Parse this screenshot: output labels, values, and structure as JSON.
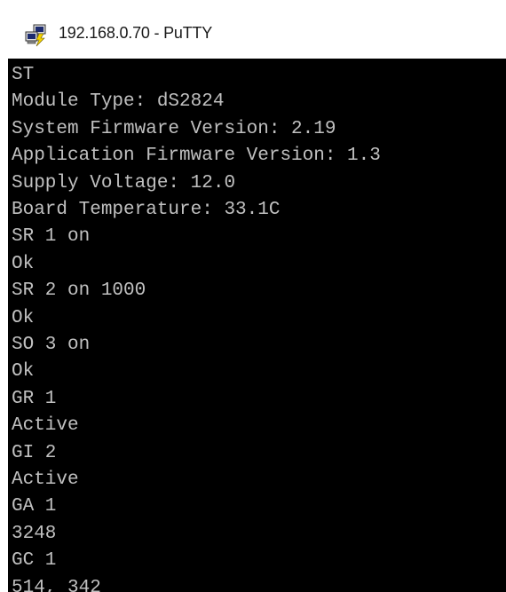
{
  "window": {
    "title": "192.168.0.70 - PuTTY",
    "icon": "putty-icon"
  },
  "colors": {
    "terminal_bg": "#000000",
    "terminal_fg": "#c0c0c0",
    "titlebar_bg": "#ffffff"
  },
  "terminal": {
    "lines": [
      "ST",
      "Module Type: dS2824",
      "System Firmware Version: 2.19",
      "Application Firmware Version: 1.3",
      "Supply Voltage: 12.0",
      "Board Temperature: 33.1C",
      "SR 1 on",
      "Ok",
      "SR 2 on 1000",
      "Ok",
      "SO 3 on",
      "Ok",
      "GR 1",
      "Active",
      "GI 2",
      "Active",
      "GA 1",
      "3248",
      "GC 1",
      "514, 342"
    ]
  }
}
